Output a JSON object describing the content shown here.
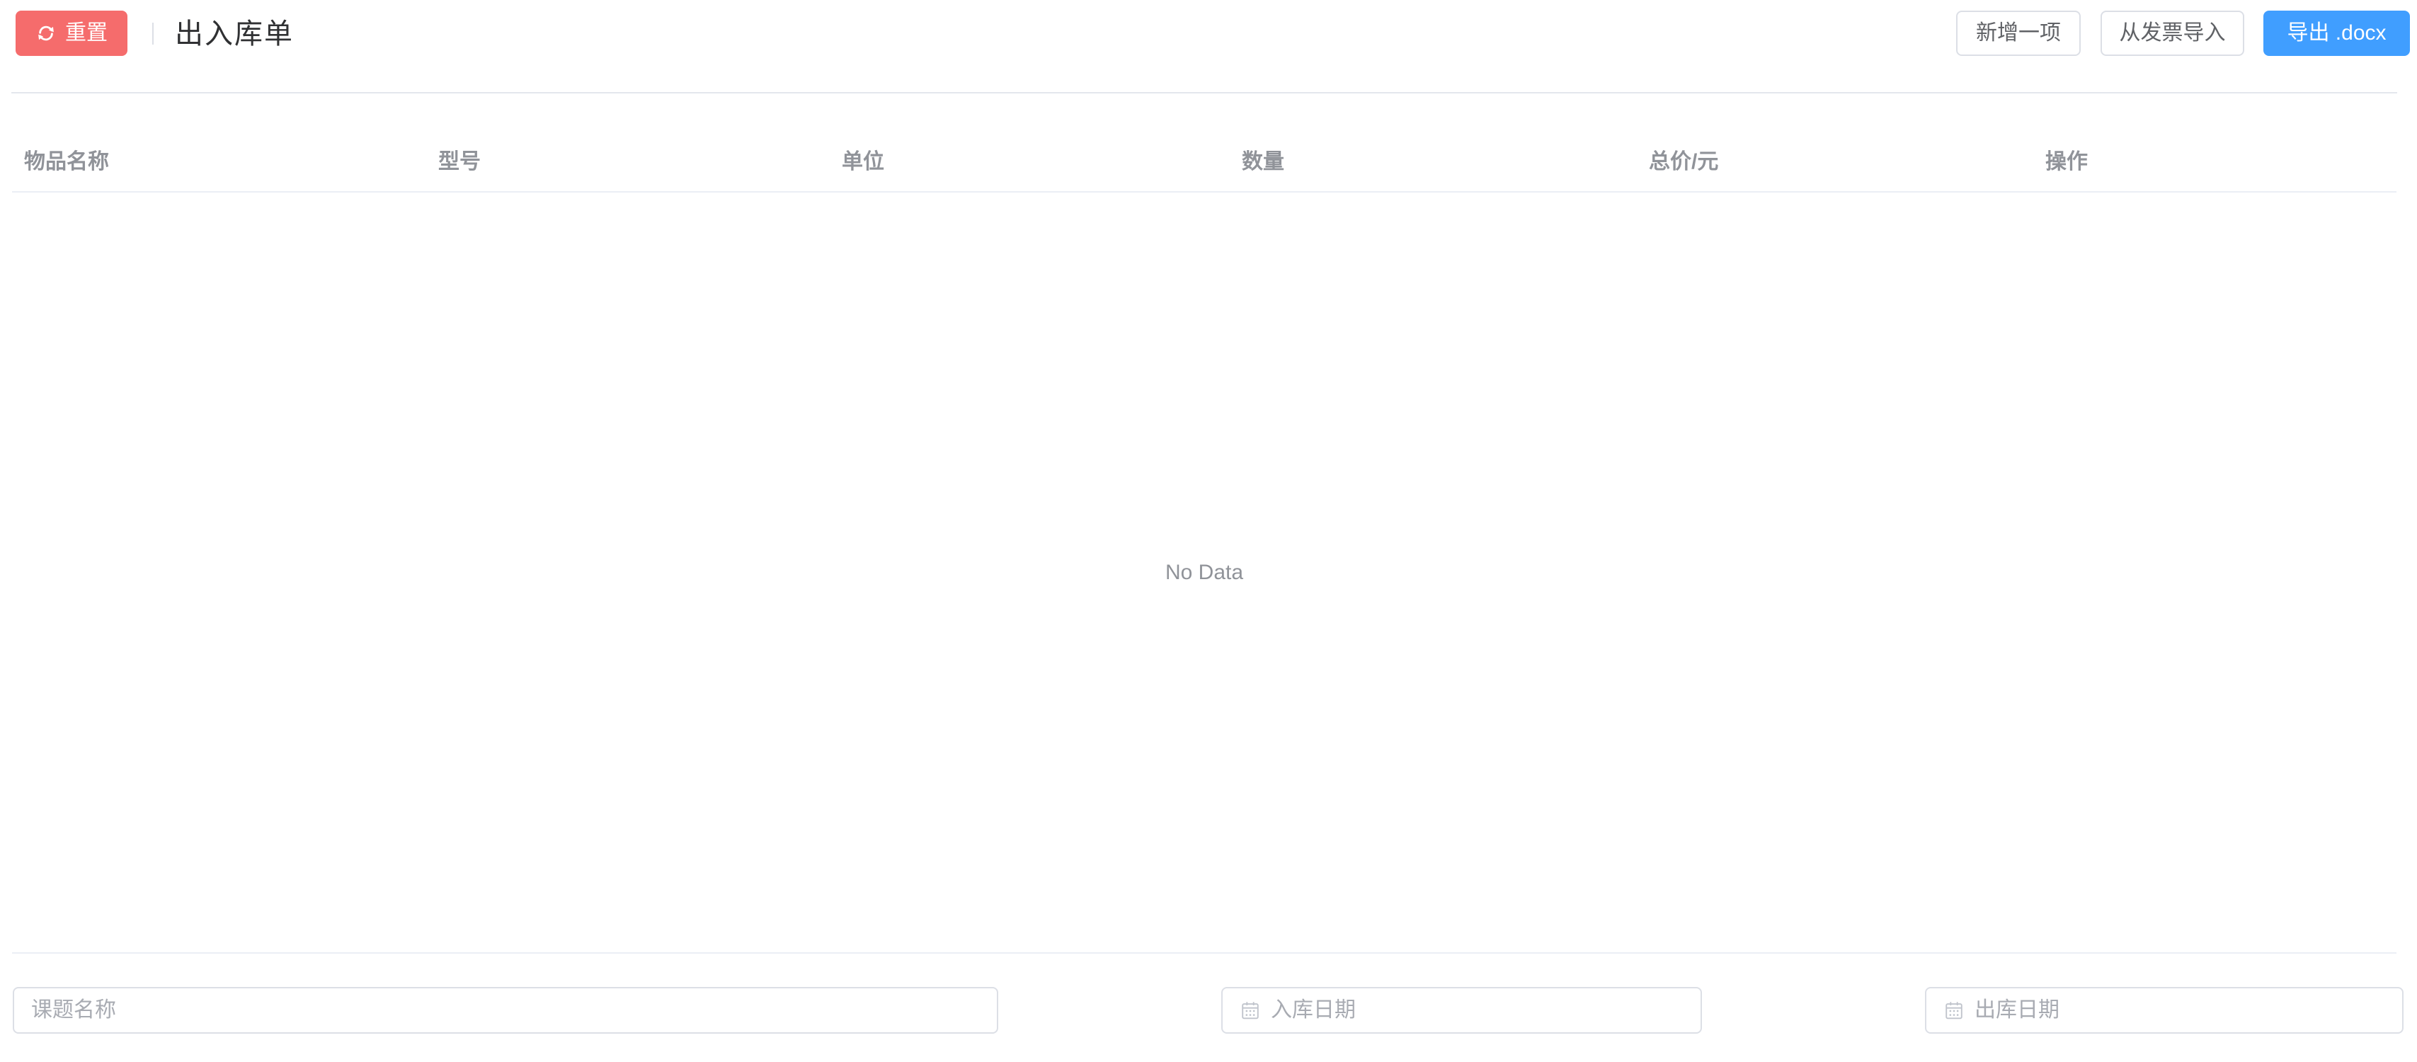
{
  "toolbar": {
    "reset_label": "重置",
    "title": "出入库单",
    "add_item_label": "新增一项",
    "import_invoice_label": "从发票导入",
    "export_label": "导出 .docx"
  },
  "table": {
    "columns": [
      "物品名称",
      "型号",
      "单位",
      "数量",
      "总价/元",
      "操作"
    ],
    "rows": [],
    "empty_text": "No Data"
  },
  "form": {
    "project_name": {
      "placeholder": "课题名称",
      "value": ""
    },
    "in_date": {
      "placeholder": "入库日期",
      "value": ""
    },
    "out_date": {
      "placeholder": "出库日期",
      "value": ""
    }
  },
  "icons": {
    "reset_button_icon": "refresh-icon",
    "date_field_icon": "calendar-icon"
  },
  "colors": {
    "danger": "#F56C6C",
    "primary": "#409EFF",
    "button_border": "#DCDFE6",
    "button_text": "#606266",
    "divider": "#E4E7ED",
    "table_border": "#EBEEF5",
    "table_header_text": "#909399",
    "empty_text": "#909399",
    "title_text": "#303133",
    "placeholder": "#A8ABB2"
  }
}
